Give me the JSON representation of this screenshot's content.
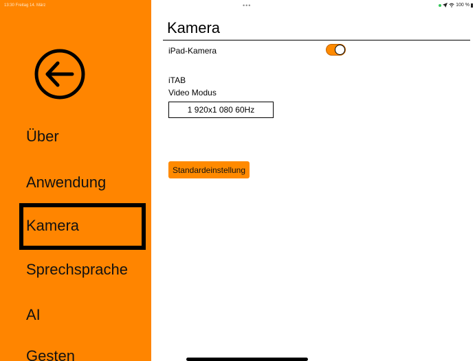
{
  "status_bar": {
    "time_date": "13:30  Freitag 14. März",
    "multitask_dots": "•••",
    "battery": "100 %"
  },
  "sidebar": {
    "back_icon": "arrow-left-circle-icon",
    "items": [
      {
        "label": "Über"
      },
      {
        "label": "Anwendung"
      },
      {
        "label": "Kamera",
        "selected": true
      },
      {
        "label": "Sprechsprache"
      },
      {
        "label": "AI"
      },
      {
        "label": "Gesten"
      }
    ]
  },
  "main": {
    "title": "Kamera",
    "ipad_camera_label": "iPad-Kamera",
    "ipad_camera_on": true,
    "itab_label": "iTAB",
    "video_mode_label": "Video Modus",
    "video_mode_value": "1 920x1 080 60Hz",
    "default_button": "Standardeinstellung"
  },
  "colors": {
    "accent": "#FF8500",
    "toggle_on": "#FF8A00",
    "wifi_indicator": "#34C759"
  }
}
